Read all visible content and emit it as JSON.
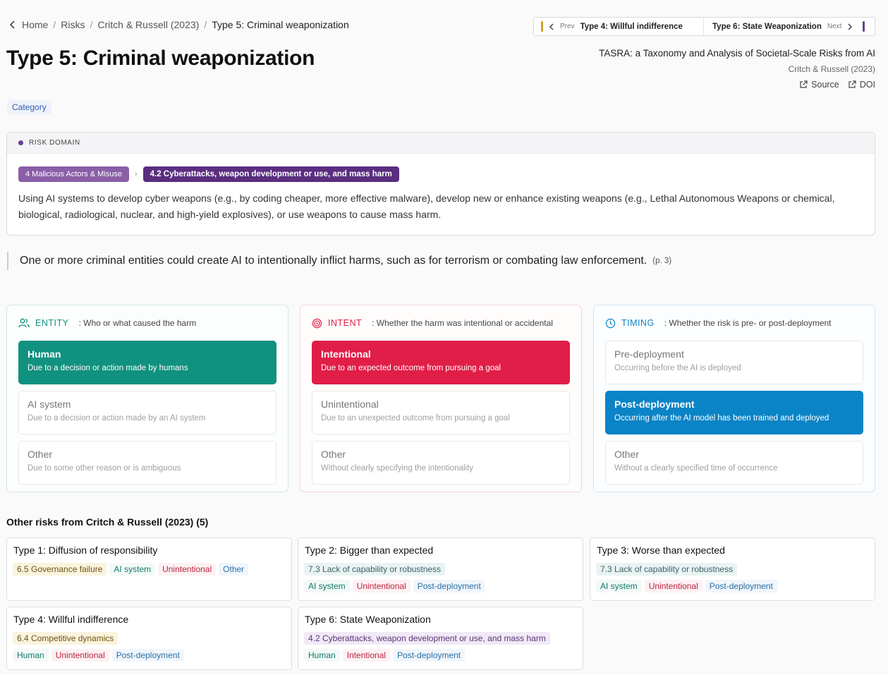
{
  "breadcrumb": {
    "items": [
      "Home",
      "Risks",
      "Critch & Russell (2023)"
    ],
    "current": "Type 5: Criminal weaponization"
  },
  "pager": {
    "prev_label": "Prev",
    "prev_title": "Type 4: Willful indifference",
    "next_title": "Type 6: State Weaponization",
    "next_label": "Next",
    "prev_color": "#c9a227",
    "next_color": "#6b3d8f"
  },
  "page_title": "Type 5: Criminal weaponization",
  "paper": {
    "title": "TASRA: a Taxonomy and Analysis of Societal-Scale Risks from AI",
    "authors": "Critch & Russell (2023)",
    "source_label": "Source",
    "doi_label": "DOI"
  },
  "category_label": "Category",
  "risk_domain": {
    "header": "RISK DOMAIN",
    "domain_chip": "4  Malicious Actors & Misuse",
    "subdomain_chip": "4.2  Cyberattacks, weapon development or use, and mass harm",
    "description": "Using AI systems to develop cyber weapons (e.g., by coding cheaper, more effective malware), develop new or enhance existing weapons (e.g., Lethal Autonomous Weapons or chemical, biological, radiological, nuclear, and high-yield explosives), or use weapons to cause mass harm."
  },
  "quote": {
    "text": "One or more criminal entities could create AI to intentionally inflict harms, such as for terrorism or combating law enforcement.",
    "page": "(p. 3)"
  },
  "causal": {
    "entity": {
      "label": "ENTITY",
      "desc": ": Who or what caused the harm",
      "color": "#11917f",
      "options": [
        {
          "title": "Human",
          "desc": "Due to a decision or action made by humans"
        },
        {
          "title": "AI system",
          "desc": "Due to a decision or action made by an AI system"
        },
        {
          "title": "Other",
          "desc": "Due to some other reason or is ambiguous"
        }
      ]
    },
    "intent": {
      "label": "INTENT",
      "desc": ": Whether the harm was intentional or accidental",
      "color": "#e01e48",
      "options": [
        {
          "title": "Intentional",
          "desc": "Due to an expected outcome from pursuing a goal"
        },
        {
          "title": "Unintentional",
          "desc": "Due to an unexpected outcome from pursuing a goal"
        },
        {
          "title": "Other",
          "desc": "Without clearly specifying the intentionality"
        }
      ]
    },
    "timing": {
      "label": "TIMING",
      "desc": ": Whether the risk is pre- or post-deployment",
      "color": "#0a84c6",
      "options": [
        {
          "title": "Pre-deployment",
          "desc": "Occurring before the AI is deployed"
        },
        {
          "title": "Post-deployment",
          "desc": "Occurring after the AI model has been trained and deployed"
        },
        {
          "title": "Other",
          "desc": "Without a clearly specified time of occurrence"
        }
      ]
    }
  },
  "other_risks": {
    "title": "Other risks from Critch & Russell (2023) (5)",
    "items": [
      {
        "title": "Type 1: Diffusion of responsibility",
        "domain": "6.5 Governance failure",
        "entity": "AI system",
        "intent": "Unintentional",
        "timing": "Other"
      },
      {
        "title": "Type 2: Bigger than expected",
        "domain": "7.3 Lack of capability or robustness",
        "entity": "AI system",
        "intent": "Unintentional",
        "timing": "Post-deployment"
      },
      {
        "title": "Type 3: Worse than expected",
        "domain": "7.3 Lack of capability or robustness",
        "entity": "AI system",
        "intent": "Unintentional",
        "timing": "Post-deployment"
      },
      {
        "title": "Type 4: Willful indifference",
        "domain": "6.4 Competitive dynamics",
        "entity": "Human",
        "intent": "Unintentional",
        "timing": "Post-deployment"
      },
      {
        "title": "Type 6: State Weaponization",
        "domain": "4.2 Cyberattacks, weapon development or use, and mass harm",
        "entity": "Human",
        "intent": "Intentional",
        "timing": "Post-deployment"
      }
    ]
  }
}
